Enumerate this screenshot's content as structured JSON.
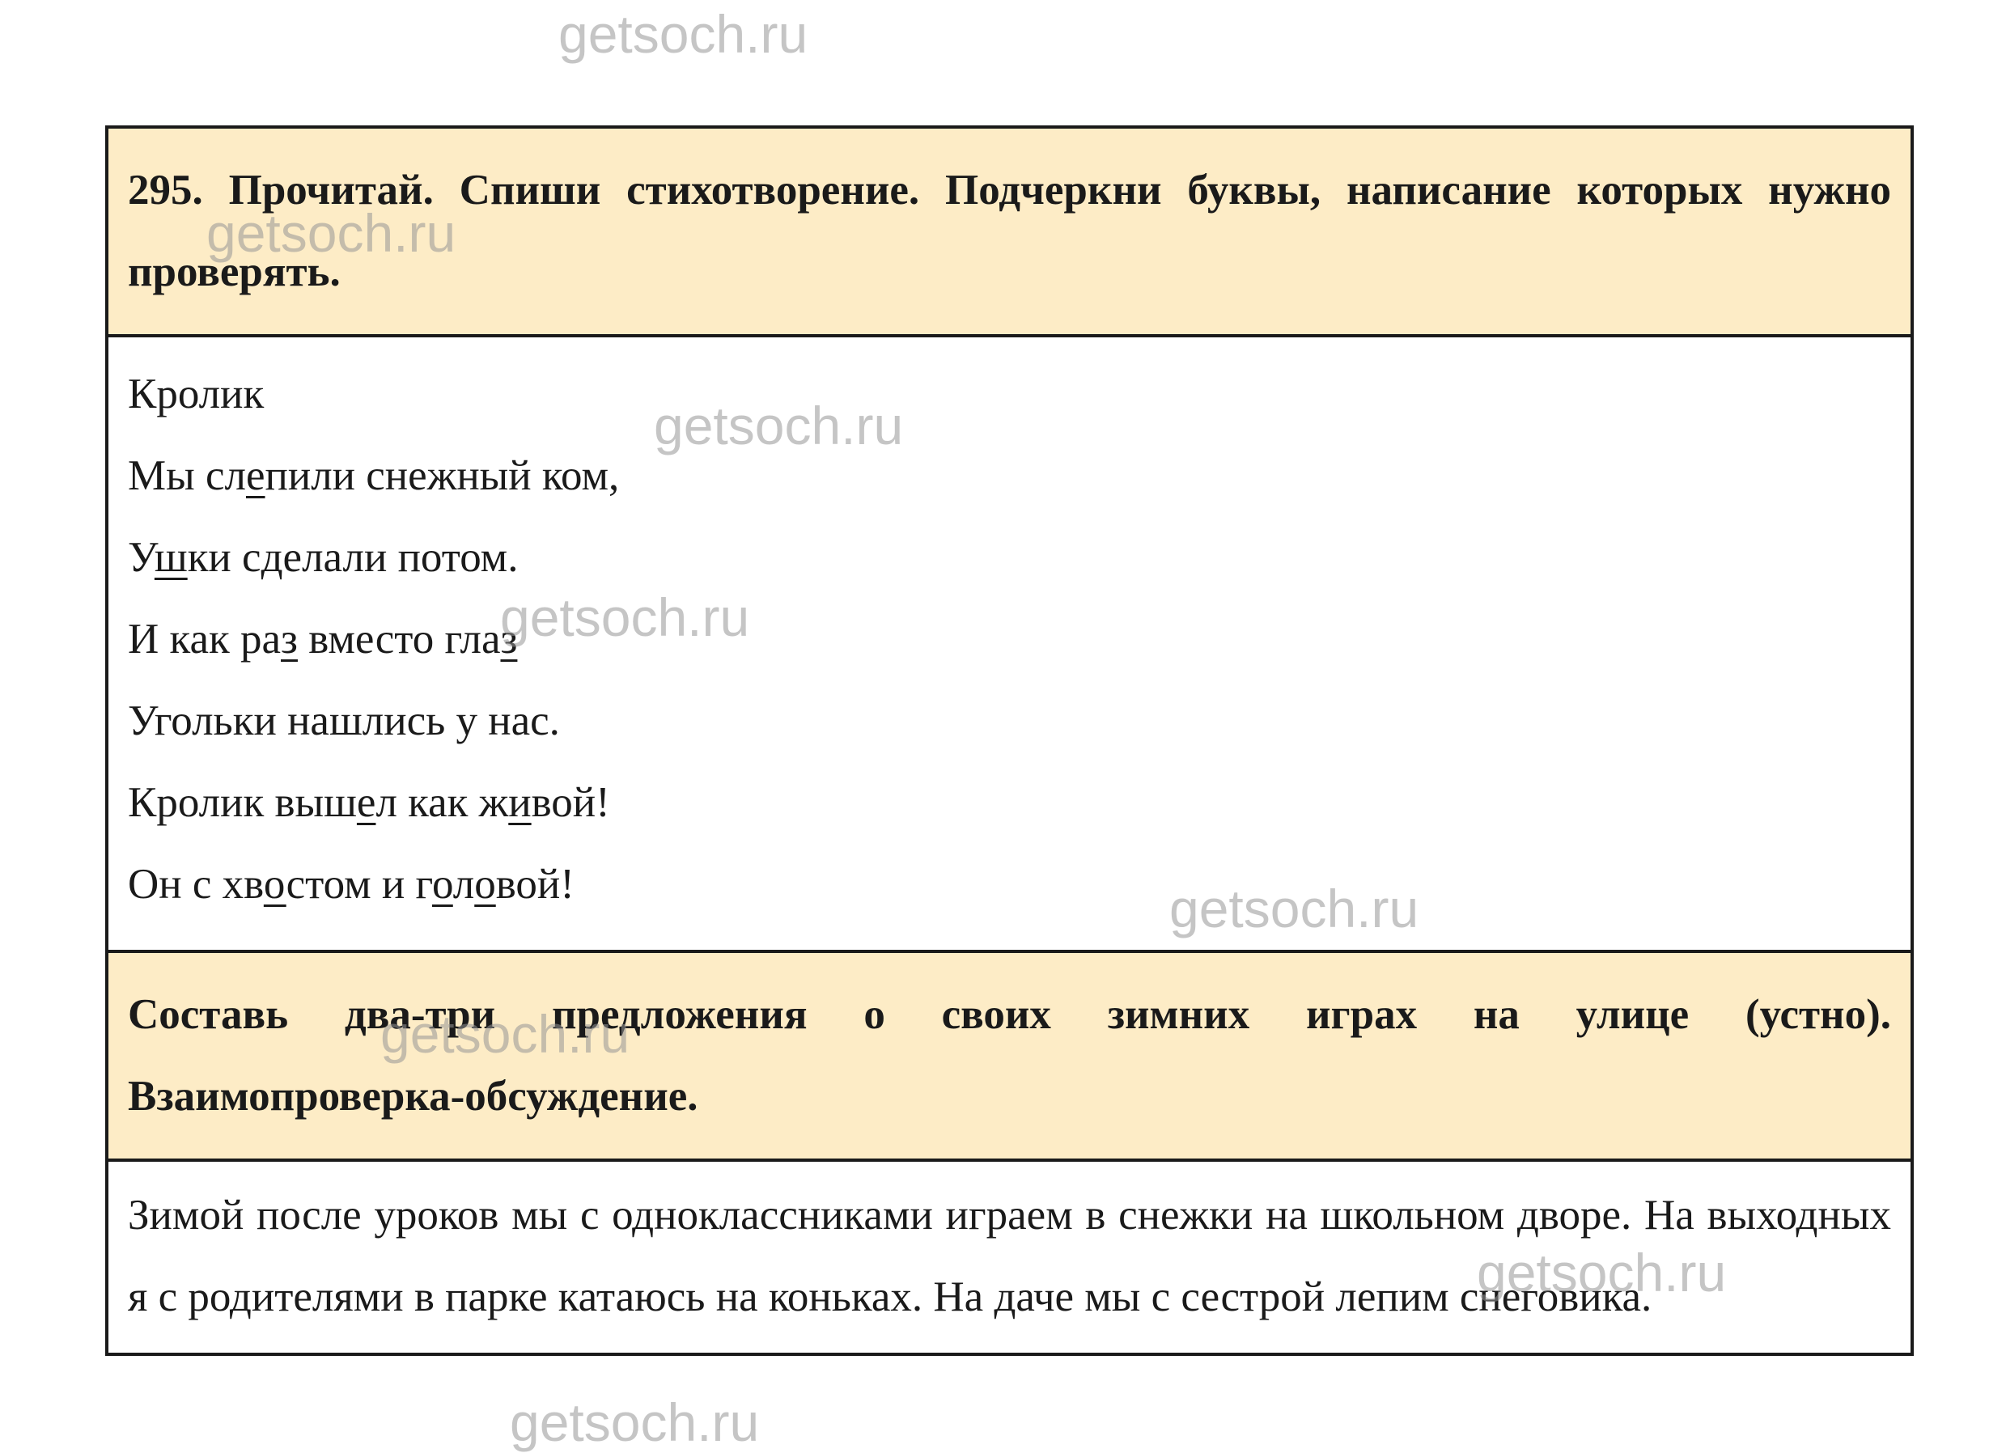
{
  "watermark_text": "getsoch.ru",
  "task1": {
    "text": "295. Прочитай. Спиши стихотворение. Подчеркни буквы, написание которых нужно проверять."
  },
  "poem": {
    "title": "Кролик",
    "lines": [
      [
        {
          "t": "Мы сл"
        },
        {
          "t": "е",
          "u": true
        },
        {
          "t": "пили снежный ком,"
        }
      ],
      [
        {
          "t": "У"
        },
        {
          "t": "ш",
          "u": true
        },
        {
          "t": "ки сделали потом."
        }
      ],
      [
        {
          "t": "И как ра"
        },
        {
          "t": "з",
          "u": true
        },
        {
          "t": " вместо гла"
        },
        {
          "t": "з",
          "u": true
        }
      ],
      [
        {
          "t": "Угольки нашлись у нас."
        }
      ],
      [
        {
          "t": "Кролик выш"
        },
        {
          "t": "е",
          "u": true
        },
        {
          "t": "л как ж"
        },
        {
          "t": "и",
          "u": true
        },
        {
          "t": "вой!"
        }
      ],
      [
        {
          "t": "Он с хв"
        },
        {
          "t": "о",
          "u": true
        },
        {
          "t": "стом и г"
        },
        {
          "t": "о",
          "u": true
        },
        {
          "t": "л"
        },
        {
          "t": "о",
          "u": true
        },
        {
          "t": "вой!"
        }
      ]
    ]
  },
  "task2": {
    "text": "Составь два‑три предложения о своих зимних играх на улице (устно). Взаимопроверка‑обсуждение."
  },
  "answer": {
    "text": "Зимой после уроков мы с одноклассниками играем в снежки на школьном дворе. На выходных я с родителями в парке катаюсь на коньках. На даче мы с сестрой лепим снеговика."
  }
}
